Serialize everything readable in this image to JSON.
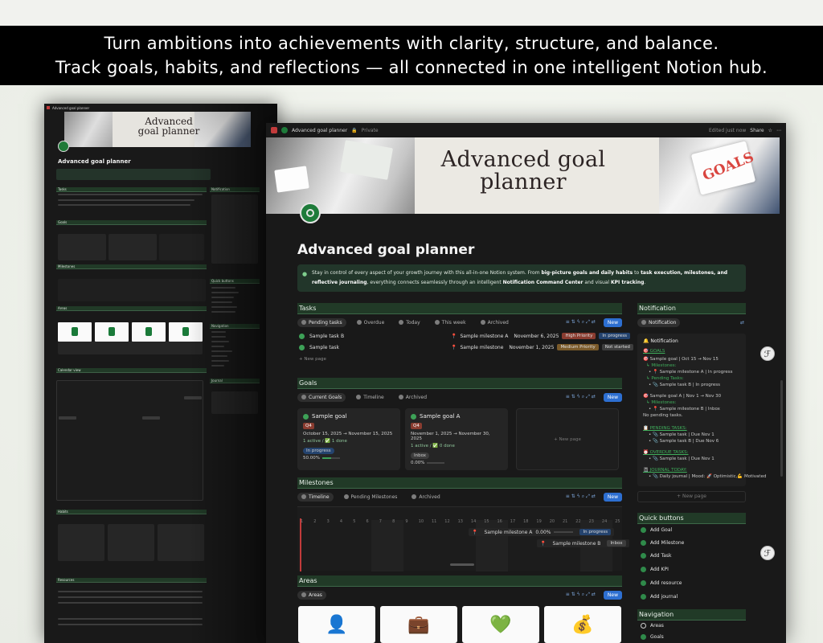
{
  "banner": {
    "line1": "Turn ambitions into achievements with clarity, structure, and balance.",
    "line2": "Track goals, habits, and reflections — all connected in one intelligent Notion hub."
  },
  "topbar": {
    "page_name": "Advanced goal planner",
    "privacy": "Private",
    "edited": "Edited just now",
    "share": "Share"
  },
  "cover_title": "Advanced goal planner",
  "page_title": "Advanced goal planner",
  "callout": {
    "t1": "Stay in control of every aspect of your growth journey with this all-in-one Notion system. From ",
    "b1": "big-picture goals and daily habits",
    "t2": " to ",
    "b2": "task execution, milestones, and reflective journaling",
    "t3": ", everything connects seamlessly through an intelligent ",
    "b3": "Notification Command Center",
    "t4": " and visual ",
    "b4": "KPI tracking",
    "t5": "."
  },
  "tasks": {
    "title": "Tasks",
    "tabs": [
      "Pending tasks",
      "Overdue",
      "Today",
      "This week",
      "Archived"
    ],
    "new": "New",
    "rows": [
      {
        "name": "Sample task B",
        "milestone": "Sample milestone A",
        "date": "November 6, 2025",
        "priority": "High Priority",
        "status": "In progress"
      },
      {
        "name": "Sample task",
        "milestone": "Sample milestone",
        "date": "November 1, 2025",
        "priority": "Medium Priority",
        "status": "Not started"
      }
    ],
    "new_page": "New page"
  },
  "goals": {
    "title": "Goals",
    "tabs": [
      "Current Goals",
      "Timeline",
      "Archived"
    ],
    "new": "New",
    "cards": [
      {
        "name": "Sample goal",
        "tag": "Q4",
        "dates": "October 15, 2025 → November 15, 2025",
        "progress_text": "1 active / ✅ 1 done",
        "status": "In progress",
        "percent": "50.00%",
        "fraction": 0.5
      },
      {
        "name": "Sample goal A",
        "tag": "Q4",
        "dates": "November 1, 2025 → November 30, 2025",
        "progress_text": "1 active / ✅ 0 done",
        "status": "Inbox",
        "percent": "0.00%",
        "fraction": 0
      }
    ],
    "new_page": "New page"
  },
  "milestones": {
    "title": "Milestones",
    "tabs": [
      "Timeline",
      "Pending Milestones",
      "Archived"
    ],
    "days": [
      "1",
      "2",
      "3",
      "4",
      "5",
      "6",
      "7",
      "8",
      "9",
      "10",
      "11",
      "12",
      "13",
      "14",
      "15",
      "16",
      "17",
      "18",
      "19",
      "20",
      "21",
      "22",
      "23",
      "24",
      "25"
    ],
    "items": [
      {
        "name": "Sample milestone A",
        "percent": "0.00%",
        "status": "In progress"
      },
      {
        "name": "Sample milestone B",
        "status": "Inbox"
      }
    ]
  },
  "areas": {
    "title": "Areas",
    "tab": "Areas",
    "new": "New",
    "icons": [
      "person-icon",
      "briefcase-icon",
      "heart-icon",
      "money-bag-icon"
    ]
  },
  "notification": {
    "title": "Notification",
    "tab": "Notification",
    "panel_title": "Notification",
    "lines": [
      "🎯 GOALS",
      "🎯 Sample goal | Oct 15 → Nov 15",
      "↳ Milestones:",
      "• 📍 Sample milestone A | In progress",
      "↳ Pending Tasks:",
      "• 📎 Sample task B | In progress",
      "🎯 Sample goal A | Nov 1 → Nov 30",
      "↳ Milestones:",
      "• 📍 Sample milestone B | Inbox",
      "No pending tasks.",
      "📋 PENDING TASKS:",
      "• 📎 Sample task | Due Nov 1",
      "• 📎 Sample task B | Due Nov 6",
      "⏰ OVERDUE TASKS:",
      "• 📎 Sample task | Due Nov 1",
      "📓 JOURNAL TODAY:",
      "• 📎 Daily journal | Mood: 🚀 Optimistic,💪 Motivated"
    ],
    "new_page": "New page"
  },
  "quick_buttons": {
    "title": "Quick buttons",
    "items": [
      "Add Goal",
      "Add Milestone",
      "Add Task",
      "Add KPI",
      "Add resource",
      "Add journal"
    ]
  },
  "navigation": {
    "title": "Navigation",
    "items": [
      "Areas",
      "Goals"
    ]
  },
  "mini": {
    "title": "Advanced goal planner",
    "cover_title": "Advanced goal planner",
    "topbar": "Advanced goal planner",
    "sections": [
      "Tasks",
      "Notification",
      "Goals",
      "Milestones",
      "Quick buttons",
      "Areas",
      "Navigation",
      "Calendar view",
      "Journal",
      "Habits",
      "Resources"
    ]
  },
  "colors": {
    "accent_green": "#213a27",
    "new_button": "#2d6fd1",
    "high_priority": "#8a3c30",
    "medium_priority": "#7a5a2a",
    "in_progress": "#24436e",
    "not_started": "#3d3d3d"
  }
}
